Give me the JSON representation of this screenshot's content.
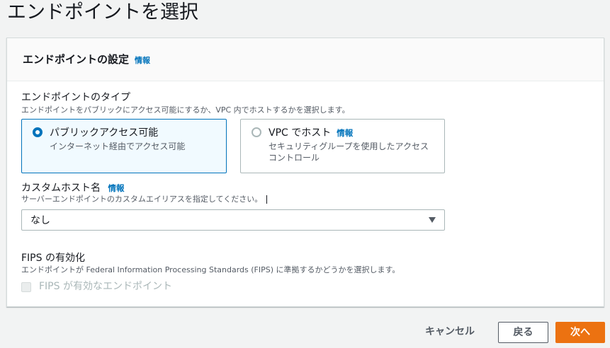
{
  "page": {
    "title": "エンドポイントを選択"
  },
  "panel": {
    "title": "エンドポイントの設定",
    "info_label": "情報"
  },
  "endpoint_type": {
    "label": "エンドポイントのタイプ",
    "description": "エンドポイントをパブリックにアクセス可能にするか、VPC 内でホストするかを選択します。",
    "options": [
      {
        "title": "パブリックアクセス可能",
        "description": "インターネット経由でアクセス可能",
        "selected": true
      },
      {
        "title": "VPC でホスト",
        "info_label": "情報",
        "description": "セキュリティグループを使用したアクセスコントロール",
        "selected": false
      }
    ]
  },
  "custom_host": {
    "label": "カスタムホスト名",
    "info_label": "情報",
    "description": "サーバーエンドポイントのカスタムエイリアスを指定してください。",
    "selected_value": "なし"
  },
  "fips": {
    "label": "FIPS の有効化",
    "description": "エンドポイントが Federal Information Processing Standards (FIPS) に準拠するかどうかを選択します。",
    "checkbox_label": "FIPS が有効なエンドポイント",
    "checked": false,
    "disabled": true
  },
  "footer": {
    "cancel_label": "キャンセル",
    "back_label": "戻る",
    "next_label": "次へ"
  },
  "colors": {
    "accent": "#0073bb",
    "primary_button": "#ec7211",
    "background": "#f2f3f3"
  }
}
